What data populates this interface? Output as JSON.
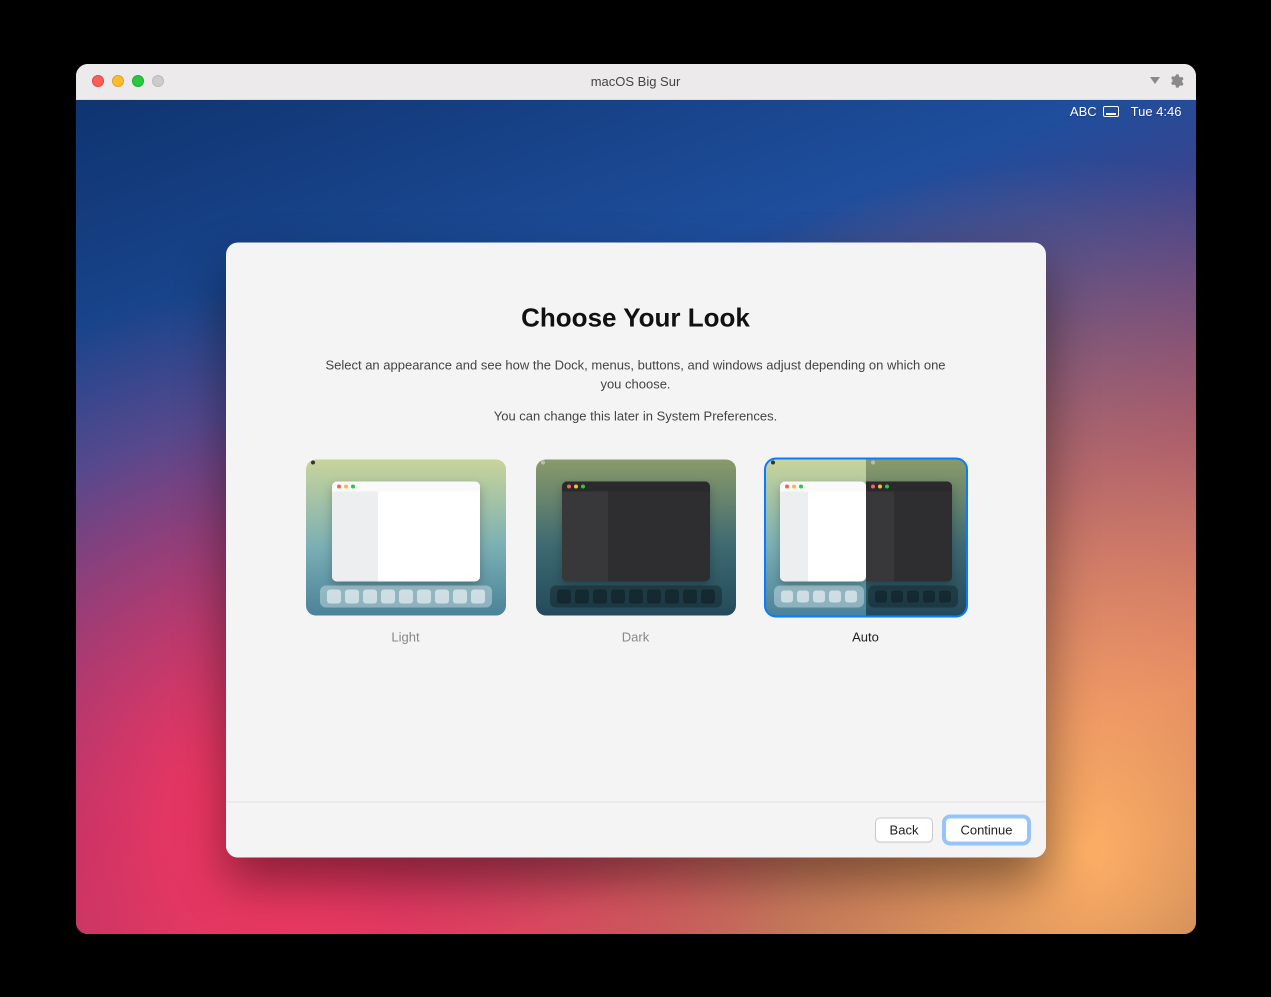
{
  "window": {
    "title": "macOS Big Sur"
  },
  "menubar": {
    "input_label": "ABC",
    "clock": "Tue 4:46"
  },
  "dialog": {
    "heading": "Choose Your Look",
    "description": "Select an appearance and see how the Dock, menus, buttons, and windows adjust depending on which one you choose.",
    "subtext": "You can change this later in System Preferences.",
    "options": {
      "light": "Light",
      "dark": "Dark",
      "auto": "Auto"
    },
    "selected": "auto",
    "buttons": {
      "back": "Back",
      "continue": "Continue"
    }
  }
}
